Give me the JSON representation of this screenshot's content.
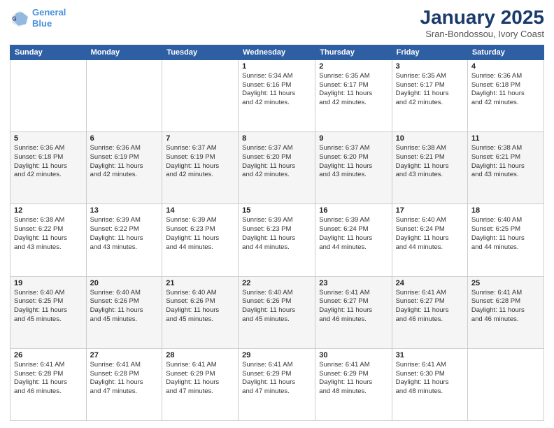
{
  "header": {
    "logo_line1": "General",
    "logo_line2": "Blue",
    "month_title": "January 2025",
    "location": "Sran-Bondossou, Ivory Coast"
  },
  "days_of_week": [
    "Sunday",
    "Monday",
    "Tuesday",
    "Wednesday",
    "Thursday",
    "Friday",
    "Saturday"
  ],
  "weeks": [
    [
      {
        "day": "",
        "info": ""
      },
      {
        "day": "",
        "info": ""
      },
      {
        "day": "",
        "info": ""
      },
      {
        "day": "1",
        "info": "Sunrise: 6:34 AM\nSunset: 6:16 PM\nDaylight: 11 hours\nand 42 minutes."
      },
      {
        "day": "2",
        "info": "Sunrise: 6:35 AM\nSunset: 6:17 PM\nDaylight: 11 hours\nand 42 minutes."
      },
      {
        "day": "3",
        "info": "Sunrise: 6:35 AM\nSunset: 6:17 PM\nDaylight: 11 hours\nand 42 minutes."
      },
      {
        "day": "4",
        "info": "Sunrise: 6:36 AM\nSunset: 6:18 PM\nDaylight: 11 hours\nand 42 minutes."
      }
    ],
    [
      {
        "day": "5",
        "info": "Sunrise: 6:36 AM\nSunset: 6:18 PM\nDaylight: 11 hours\nand 42 minutes."
      },
      {
        "day": "6",
        "info": "Sunrise: 6:36 AM\nSunset: 6:19 PM\nDaylight: 11 hours\nand 42 minutes."
      },
      {
        "day": "7",
        "info": "Sunrise: 6:37 AM\nSunset: 6:19 PM\nDaylight: 11 hours\nand 42 minutes."
      },
      {
        "day": "8",
        "info": "Sunrise: 6:37 AM\nSunset: 6:20 PM\nDaylight: 11 hours\nand 42 minutes."
      },
      {
        "day": "9",
        "info": "Sunrise: 6:37 AM\nSunset: 6:20 PM\nDaylight: 11 hours\nand 43 minutes."
      },
      {
        "day": "10",
        "info": "Sunrise: 6:38 AM\nSunset: 6:21 PM\nDaylight: 11 hours\nand 43 minutes."
      },
      {
        "day": "11",
        "info": "Sunrise: 6:38 AM\nSunset: 6:21 PM\nDaylight: 11 hours\nand 43 minutes."
      }
    ],
    [
      {
        "day": "12",
        "info": "Sunrise: 6:38 AM\nSunset: 6:22 PM\nDaylight: 11 hours\nand 43 minutes."
      },
      {
        "day": "13",
        "info": "Sunrise: 6:39 AM\nSunset: 6:22 PM\nDaylight: 11 hours\nand 43 minutes."
      },
      {
        "day": "14",
        "info": "Sunrise: 6:39 AM\nSunset: 6:23 PM\nDaylight: 11 hours\nand 44 minutes."
      },
      {
        "day": "15",
        "info": "Sunrise: 6:39 AM\nSunset: 6:23 PM\nDaylight: 11 hours\nand 44 minutes."
      },
      {
        "day": "16",
        "info": "Sunrise: 6:39 AM\nSunset: 6:24 PM\nDaylight: 11 hours\nand 44 minutes."
      },
      {
        "day": "17",
        "info": "Sunrise: 6:40 AM\nSunset: 6:24 PM\nDaylight: 11 hours\nand 44 minutes."
      },
      {
        "day": "18",
        "info": "Sunrise: 6:40 AM\nSunset: 6:25 PM\nDaylight: 11 hours\nand 44 minutes."
      }
    ],
    [
      {
        "day": "19",
        "info": "Sunrise: 6:40 AM\nSunset: 6:25 PM\nDaylight: 11 hours\nand 45 minutes."
      },
      {
        "day": "20",
        "info": "Sunrise: 6:40 AM\nSunset: 6:26 PM\nDaylight: 11 hours\nand 45 minutes."
      },
      {
        "day": "21",
        "info": "Sunrise: 6:40 AM\nSunset: 6:26 PM\nDaylight: 11 hours\nand 45 minutes."
      },
      {
        "day": "22",
        "info": "Sunrise: 6:40 AM\nSunset: 6:26 PM\nDaylight: 11 hours\nand 45 minutes."
      },
      {
        "day": "23",
        "info": "Sunrise: 6:41 AM\nSunset: 6:27 PM\nDaylight: 11 hours\nand 46 minutes."
      },
      {
        "day": "24",
        "info": "Sunrise: 6:41 AM\nSunset: 6:27 PM\nDaylight: 11 hours\nand 46 minutes."
      },
      {
        "day": "25",
        "info": "Sunrise: 6:41 AM\nSunset: 6:28 PM\nDaylight: 11 hours\nand 46 minutes."
      }
    ],
    [
      {
        "day": "26",
        "info": "Sunrise: 6:41 AM\nSunset: 6:28 PM\nDaylight: 11 hours\nand 46 minutes."
      },
      {
        "day": "27",
        "info": "Sunrise: 6:41 AM\nSunset: 6:28 PM\nDaylight: 11 hours\nand 47 minutes."
      },
      {
        "day": "28",
        "info": "Sunrise: 6:41 AM\nSunset: 6:29 PM\nDaylight: 11 hours\nand 47 minutes."
      },
      {
        "day": "29",
        "info": "Sunrise: 6:41 AM\nSunset: 6:29 PM\nDaylight: 11 hours\nand 47 minutes."
      },
      {
        "day": "30",
        "info": "Sunrise: 6:41 AM\nSunset: 6:29 PM\nDaylight: 11 hours\nand 48 minutes."
      },
      {
        "day": "31",
        "info": "Sunrise: 6:41 AM\nSunset: 6:30 PM\nDaylight: 11 hours\nand 48 minutes."
      },
      {
        "day": "",
        "info": ""
      }
    ]
  ]
}
